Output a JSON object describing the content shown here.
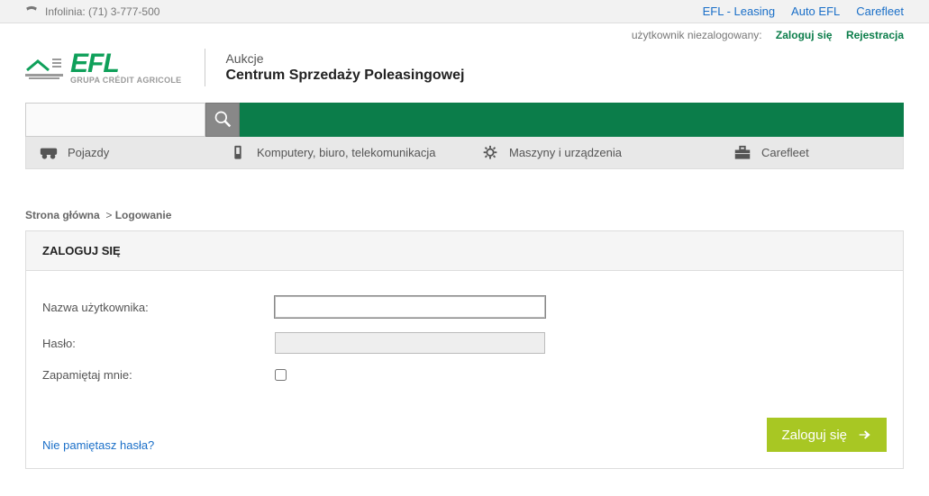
{
  "topbar": {
    "infolinia_label": "Infolinia: (71) 3-777-500",
    "links": [
      "EFL - Leasing",
      "Auto EFL",
      "Carefleet"
    ]
  },
  "userbar": {
    "status": "użytkownik niezalogowany:",
    "login_link": "Zaloguj się",
    "register_link": "Rejestracja"
  },
  "logo": {
    "efl": "EFL",
    "grupa": "GRUPA CRÉDIT AGRICOLE"
  },
  "title": {
    "small": "Aukcje",
    "big": "Centrum Sprzedaży Poleasingowej"
  },
  "search": {
    "placeholder": ""
  },
  "categories": [
    {
      "label": "Pojazdy"
    },
    {
      "label": "Komputery, biuro, telekomunikacja"
    },
    {
      "label": "Maszyny i urządzenia"
    },
    {
      "label": "Carefleet"
    }
  ],
  "breadcrumb": {
    "home": "Strona główna",
    "sep": ">",
    "current": "Logowanie"
  },
  "panel": {
    "title": "ZALOGUJ SIĘ",
    "username_label": "Nazwa użytkownika:",
    "password_label": "Hasło:",
    "remember_label": "Zapamiętaj mnie:",
    "forgot": "Nie pamiętasz hasła?",
    "submit": "Zaloguj się"
  }
}
